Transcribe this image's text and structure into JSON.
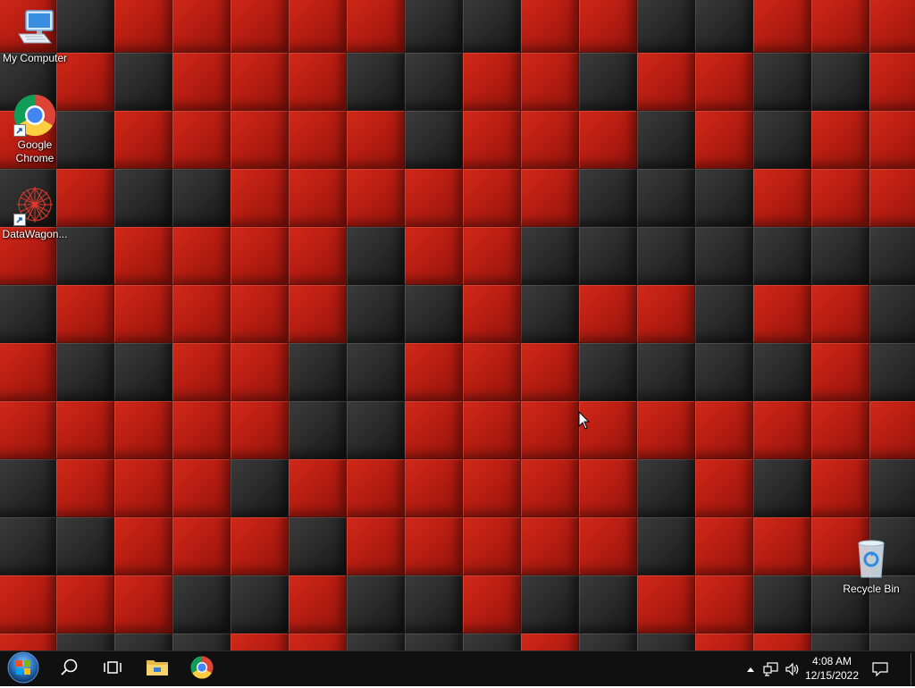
{
  "desktop": {
    "icons": [
      {
        "label": "My Computer",
        "icon": "computer-icon"
      },
      {
        "label": "Google Chrome",
        "icon": "chrome-icon"
      },
      {
        "label": "DataWagon...",
        "icon": "datawagon-icon"
      },
      {
        "label": "Recycle Bin",
        "icon": "recycle-bin-icon"
      }
    ]
  },
  "taskbar": {
    "buttons": [
      {
        "name": "Start",
        "icon": "windows-logo-icon"
      },
      {
        "name": "Search",
        "icon": "search-icon"
      },
      {
        "name": "Task View",
        "icon": "task-view-icon"
      },
      {
        "name": "File Explorer",
        "icon": "folder-icon"
      },
      {
        "name": "Google Chrome",
        "icon": "chrome-icon"
      }
    ],
    "tray": {
      "time": "4:08 AM",
      "date": "12/15/2022"
    }
  },
  "colors": {
    "wall_red": "#c8231a",
    "wall_black": "#2a2a2a",
    "taskbar_bg": "#101010"
  }
}
